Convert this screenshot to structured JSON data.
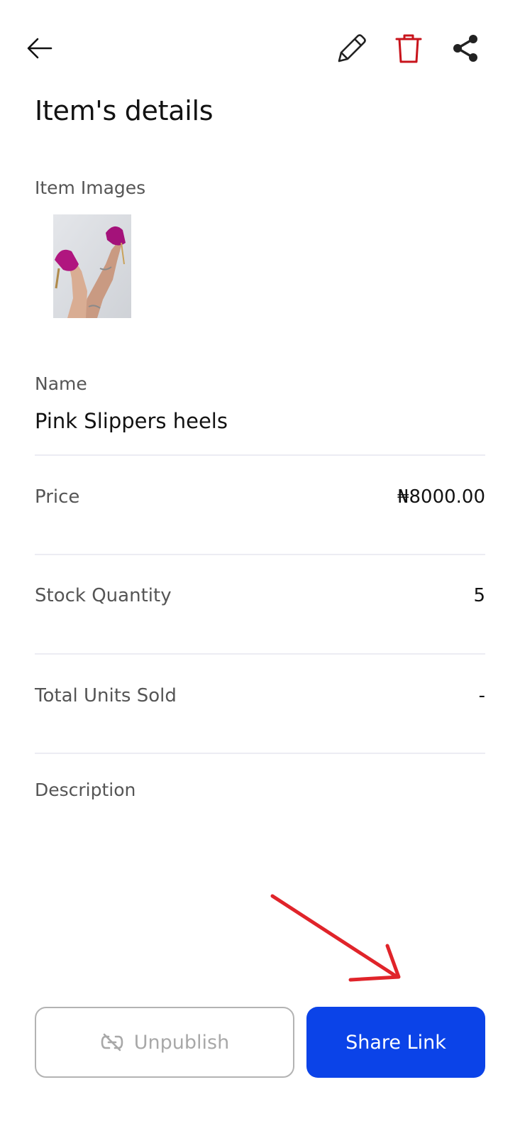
{
  "header": {
    "title": "Item's details"
  },
  "icons": {
    "back": "arrow-left-icon",
    "edit": "pencil-icon",
    "delete": "trash-icon",
    "share": "share-icon",
    "unpublish": "unlink-icon"
  },
  "images": {
    "label": "Item Images"
  },
  "item": {
    "name_label": "Name",
    "name": "Pink Slippers heels",
    "price_label": "Price",
    "price": "₦8000.00",
    "stock_label": "Stock Quantity",
    "stock": "5",
    "sold_label": "Total Units Sold",
    "sold": "-",
    "description_label": "Description"
  },
  "actions": {
    "unpublish_label": "Unpublish",
    "share_link_label": "Share Link"
  },
  "colors": {
    "delete_icon": "#c8141c",
    "primary_button": "#0b43e8",
    "annotation_arrow": "#e0242a"
  }
}
